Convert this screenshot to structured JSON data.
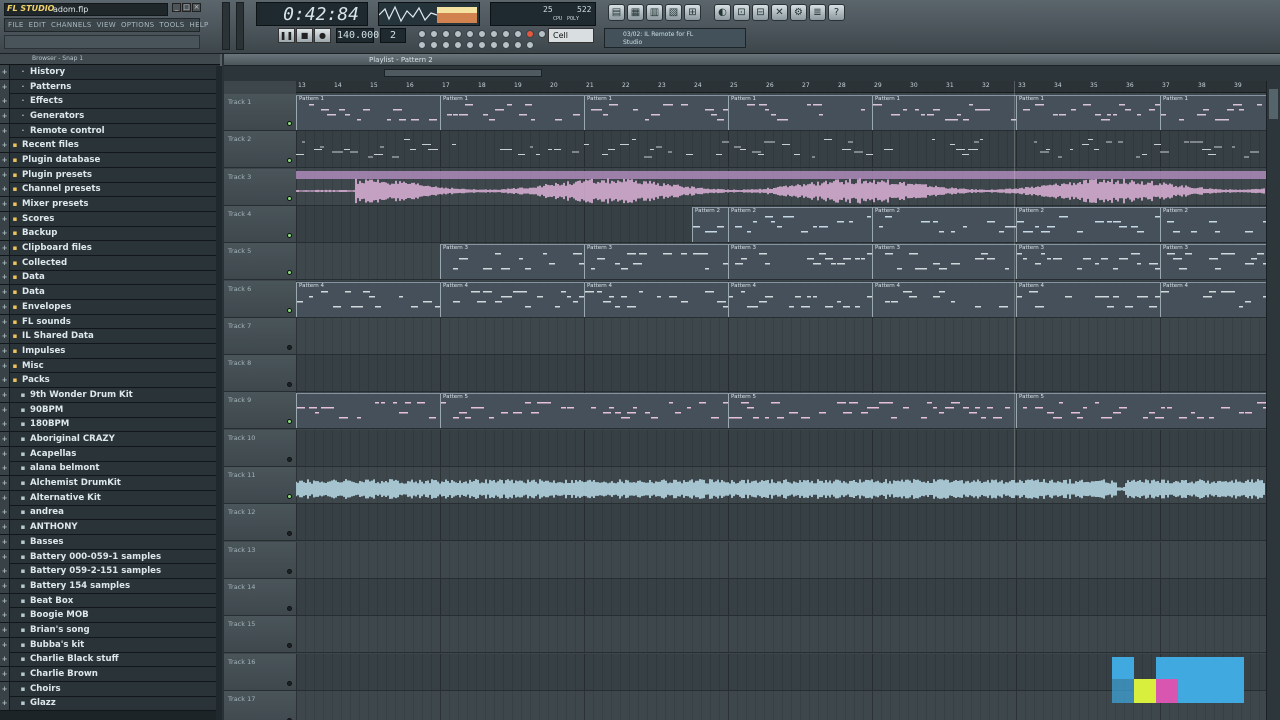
{
  "window": {
    "app_logo": "FL STUDIO",
    "file_name": "adom.flp"
  },
  "menu": [
    "FILE",
    "EDIT",
    "CHANNELS",
    "VIEW",
    "OPTIONS",
    "TOOLS",
    "HELP"
  ],
  "transport": {
    "time": "0:42:84",
    "tempo": "140.000",
    "pattern": "2",
    "snap": "Cell",
    "cpu_readout": "25",
    "poly_readout": "522",
    "cpu_label": "CPU",
    "poly_label": "POLY"
  },
  "hint_panel": {
    "line1": "03/02: IL Remote for FL",
    "line2": "Studio"
  },
  "browser": {
    "header": "Browser - Snap 1",
    "items": [
      {
        "label": "History",
        "icon": "history-icon",
        "level": 1
      },
      {
        "label": "Patterns",
        "icon": "patterns-icon",
        "level": 1
      },
      {
        "label": "Effects",
        "icon": "effects-icon",
        "level": 1
      },
      {
        "label": "Generators",
        "icon": "generators-icon",
        "level": 1
      },
      {
        "label": "Remote control",
        "icon": "remote-icon",
        "level": 1
      },
      {
        "label": "Recent files",
        "icon": "folder-icon",
        "level": 0
      },
      {
        "label": "Plugin database",
        "icon": "folder-icon",
        "level": 0
      },
      {
        "label": "Plugin presets",
        "icon": "folder-icon",
        "level": 0
      },
      {
        "label": "Channel presets",
        "icon": "folder-icon",
        "level": 0
      },
      {
        "label": "Mixer presets",
        "icon": "folder-icon",
        "level": 0
      },
      {
        "label": "Scores",
        "icon": "folder-icon",
        "level": 0
      },
      {
        "label": "Backup",
        "icon": "folder-icon",
        "level": 0
      },
      {
        "label": "Clipboard files",
        "icon": "folder-icon",
        "level": 0
      },
      {
        "label": "Collected",
        "icon": "folder-icon",
        "level": 0
      },
      {
        "label": "Data",
        "icon": "folder-icon",
        "level": 0
      },
      {
        "label": "Data",
        "icon": "folder-icon",
        "level": 0
      },
      {
        "label": "Envelopes",
        "icon": "folder-icon",
        "level": 0
      },
      {
        "label": "FL sounds",
        "icon": "folder-icon",
        "level": 0
      },
      {
        "label": "IL Shared Data",
        "icon": "folder-icon",
        "level": 0
      },
      {
        "label": "Impulses",
        "icon": "folder-icon",
        "level": 0
      },
      {
        "label": "Misc",
        "icon": "folder-icon",
        "level": 0
      },
      {
        "label": "Packs",
        "icon": "folder-icon",
        "level": 0
      },
      {
        "label": "9th Wonder Drum Kit",
        "icon": "folder-icon",
        "level": 1
      },
      {
        "label": "90BPM",
        "icon": "folder-icon",
        "level": 1
      },
      {
        "label": "180BPM",
        "icon": "folder-icon",
        "level": 1
      },
      {
        "label": "Aboriginal CRAZY",
        "icon": "folder-icon",
        "level": 1
      },
      {
        "label": "Acapellas",
        "icon": "folder-icon",
        "level": 1
      },
      {
        "label": "alana belmont",
        "icon": "folder-icon",
        "level": 1
      },
      {
        "label": "Alchemist DrumKit",
        "icon": "folder-icon",
        "level": 1
      },
      {
        "label": "Alternative Kit",
        "icon": "folder-icon",
        "level": 1
      },
      {
        "label": "andrea",
        "icon": "folder-icon",
        "level": 1
      },
      {
        "label": "ANTHONY",
        "icon": "folder-icon",
        "level": 1
      },
      {
        "label": "Basses",
        "icon": "folder-icon",
        "level": 1
      },
      {
        "label": "Battery 000-059-1 samples",
        "icon": "folder-icon",
        "level": 1
      },
      {
        "label": "Battery 059-2-151 samples",
        "icon": "folder-icon",
        "level": 1
      },
      {
        "label": "Battery 154 samples",
        "icon": "folder-icon",
        "level": 1
      },
      {
        "label": "Beat Box",
        "icon": "folder-icon",
        "level": 1
      },
      {
        "label": "Boogie MOB",
        "icon": "folder-icon",
        "level": 1
      },
      {
        "label": "Brian's song",
        "icon": "folder-icon",
        "level": 1
      },
      {
        "label": "Bubba's kit",
        "icon": "folder-icon",
        "level": 1
      },
      {
        "label": "Charlie Black stuff",
        "icon": "folder-icon",
        "level": 1
      },
      {
        "label": "Charlie Brown",
        "icon": "folder-icon",
        "level": 1
      },
      {
        "label": "Choirs",
        "icon": "folder-icon",
        "level": 1
      },
      {
        "label": "Glazz",
        "icon": "folder-icon",
        "level": 1
      }
    ]
  },
  "playlist": {
    "title": "Playlist - Pattern 2",
    "bars": [
      "13",
      "14",
      "15",
      "16",
      "17",
      "18",
      "19",
      "20",
      "21",
      "22",
      "23",
      "24",
      "25",
      "26",
      "27",
      "28",
      "29",
      "30",
      "31",
      "32",
      "33",
      "34",
      "35",
      "36",
      "37",
      "38",
      "39"
    ],
    "tracks": [
      {
        "name": "Track 1",
        "kind": "pattern",
        "color": "#d8c4d8",
        "clips": [
          {
            "start": 0,
            "label": "Pattern 1"
          },
          {
            "start": 4,
            "label": "Pattern 1"
          },
          {
            "start": 8,
            "label": "Pattern 1"
          },
          {
            "start": 12,
            "label": "Pattern 1"
          },
          {
            "start": 16,
            "label": "Pattern 1"
          },
          {
            "start": 20,
            "label": "Pattern 1"
          },
          {
            "start": 24,
            "label": "Pattern 1"
          }
        ]
      },
      {
        "name": "Track 2",
        "kind": "notes",
        "color": "#c8d0d4",
        "clips": []
      },
      {
        "name": "Track 3",
        "kind": "audio",
        "color": "#e6b8e0",
        "clips": []
      },
      {
        "name": "Track 4",
        "kind": "pattern",
        "color": "#c6d8e6",
        "clips": [
          {
            "start": 11,
            "label": "Pattern 2"
          },
          {
            "start": 12,
            "label": "Pattern 2"
          },
          {
            "start": 16,
            "label": "Pattern 2"
          },
          {
            "start": 20,
            "label": "Pattern 2"
          },
          {
            "start": 24,
            "label": "Pattern 2"
          }
        ]
      },
      {
        "name": "Track 5",
        "kind": "pattern",
        "color": "#d0d8dc",
        "clips": [
          {
            "start": 4,
            "label": "Pattern 3"
          },
          {
            "start": 8,
            "label": "Pattern 3"
          },
          {
            "start": 12,
            "label": "Pattern 3"
          },
          {
            "start": 16,
            "label": "Pattern 3"
          },
          {
            "start": 20,
            "label": "Pattern 3"
          },
          {
            "start": 24,
            "label": "Pattern 3"
          }
        ]
      },
      {
        "name": "Track 6",
        "kind": "pattern",
        "color": "#d0d8dc",
        "clips": [
          {
            "start": 0,
            "label": "Pattern 4"
          },
          {
            "start": 4,
            "label": "Pattern 4"
          },
          {
            "start": 8,
            "label": "Pattern 4"
          },
          {
            "start": 12,
            "label": "Pattern 4"
          },
          {
            "start": 16,
            "label": "Pattern 4"
          },
          {
            "start": 20,
            "label": "Pattern 4"
          },
          {
            "start": 24,
            "label": "Pattern 4"
          }
        ]
      },
      {
        "name": "Track 7",
        "kind": "empty",
        "color": "",
        "clips": []
      },
      {
        "name": "Track 8",
        "kind": "empty",
        "color": "",
        "clips": []
      },
      {
        "name": "Track 9",
        "kind": "pattern",
        "color": "#e6c0dc",
        "clips": [
          {
            "start": 0,
            "label": ""
          },
          {
            "start": 4,
            "label": "Pattern 5"
          },
          {
            "start": 12,
            "label": "Pattern 5"
          },
          {
            "start": 20,
            "label": "Pattern 5"
          }
        ]
      },
      {
        "name": "Track 10",
        "kind": "empty",
        "color": "",
        "clips": []
      },
      {
        "name": "Track 11",
        "kind": "audio",
        "color": "#bfe4f2",
        "clips": []
      },
      {
        "name": "Track 12",
        "kind": "empty",
        "color": "",
        "clips": []
      },
      {
        "name": "Track 13",
        "kind": "empty",
        "color": "",
        "clips": []
      },
      {
        "name": "Track 14",
        "kind": "empty",
        "color": "",
        "clips": []
      },
      {
        "name": "Track 15",
        "kind": "empty",
        "color": "",
        "clips": []
      },
      {
        "name": "Track 16",
        "kind": "empty",
        "color": "",
        "clips": []
      },
      {
        "name": "Track 17",
        "kind": "empty",
        "color": "",
        "clips": []
      }
    ]
  },
  "colors": {
    "accent": "#f2b233",
    "audio_pink": "#e6b8e0",
    "audio_blue": "#bfe4f2"
  }
}
